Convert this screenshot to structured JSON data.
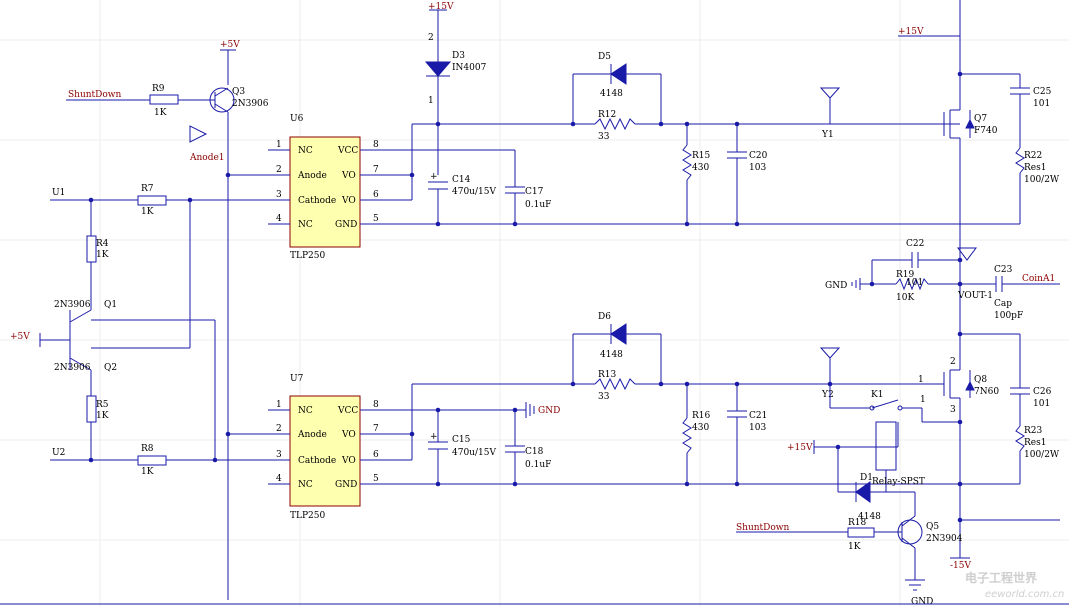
{
  "power": {
    "p15_top": "+15V",
    "p15_right": "+15V",
    "p5_q3": "+5V",
    "p5_left": "+5V",
    "p15_relay": "+15V",
    "gnd_mid": "GND",
    "gnd_c18": "GND",
    "gnd_bottom": "GND",
    "m15": "-15V"
  },
  "nets": {
    "shutdown_top": "ShuntDown",
    "shutdown_bottom": "ShuntDown",
    "u1": "U1",
    "u2": "U2",
    "coin": "CoinA1",
    "anode1": "Anode1",
    "y1": "Y1",
    "y2": "Y2",
    "vout": "VOUT-1"
  },
  "u6": {
    "ref": "U6",
    "part": "TLP250",
    "pins_left": [
      "NC",
      "Anode",
      "Cathode",
      "NC"
    ],
    "nums_left": [
      "1",
      "2",
      "3",
      "4"
    ],
    "pins_right": [
      "VCC",
      "VO",
      "VO",
      "GND"
    ],
    "nums_right": [
      "8",
      "7",
      "6",
      "5"
    ]
  },
  "u7": {
    "ref": "U7",
    "part": "TLP250",
    "pins_left": [
      "NC",
      "Anode",
      "Cathode",
      "NC"
    ],
    "nums_left": [
      "1",
      "2",
      "3",
      "4"
    ],
    "pins_right": [
      "VCC",
      "VO",
      "VO",
      "GND"
    ],
    "nums_right": [
      "8",
      "7",
      "6",
      "5"
    ]
  },
  "parts": {
    "r9": {
      "ref": "R9",
      "val": "1K"
    },
    "q3": {
      "ref": "Q3",
      "val": "2N3906"
    },
    "r7": {
      "ref": "R7",
      "val": "1K"
    },
    "r4": {
      "ref": "R4",
      "val": "1K"
    },
    "r5": {
      "ref": "R5",
      "val": "1K"
    },
    "r8": {
      "ref": "R8",
      "val": "1K"
    },
    "q1": {
      "ref": "Q1",
      "val": "2N3906"
    },
    "q2": {
      "ref": "Q2",
      "val": "2N3906"
    },
    "d3": {
      "ref": "D3",
      "val": "IN4007",
      "pin_top": "2",
      "pin_bot": "1"
    },
    "c14": {
      "ref": "C14",
      "val": "470u/15V"
    },
    "c17": {
      "ref": "C17",
      "val": "0.1uF"
    },
    "c15": {
      "ref": "C15",
      "val": "470u/15V"
    },
    "c18": {
      "ref": "C18",
      "val": "0.1uF"
    },
    "d5": {
      "ref": "D5",
      "val": "4148"
    },
    "r12": {
      "ref": "R12",
      "val": "33"
    },
    "d6": {
      "ref": "D6",
      "val": "4148"
    },
    "r13": {
      "ref": "R13",
      "val": "33"
    },
    "r15": {
      "ref": "R15",
      "val": "430"
    },
    "c20": {
      "ref": "C20",
      "val": "103"
    },
    "r16": {
      "ref": "R16",
      "val": "430"
    },
    "c21": {
      "ref": "C21",
      "val": "103"
    },
    "q7": {
      "ref": "Q7",
      "val": "F740"
    },
    "c25": {
      "ref": "C25",
      "val": "101"
    },
    "r22": {
      "ref": "R22",
      "val": "Res1",
      "val2": "100/2W"
    },
    "c22": {
      "ref": "C22",
      "val": "101"
    },
    "r19": {
      "ref": "R19",
      "val": "10K"
    },
    "c23": {
      "ref": "C23",
      "val": "Cap",
      "val2": "100pF"
    },
    "q8": {
      "ref": "Q8",
      "val": "7N60",
      "pin_top": "2",
      "pin_gate": "1",
      "pin_bot": "3"
    },
    "c26": {
      "ref": "C26",
      "val": "101"
    },
    "r23": {
      "ref": "R23",
      "val": "Res1",
      "val2": "100/2W"
    },
    "k1": {
      "ref": "K1",
      "val": "Relay-SPST"
    },
    "d1": {
      "ref": "D1",
      "val": "4148"
    },
    "r18": {
      "ref": "R18",
      "val": "1K"
    },
    "q5": {
      "ref": "Q5",
      "val": "2N3904"
    }
  },
  "watermark": {
    "cn": "电子工程世界",
    "en": "eeworld.com.cn"
  }
}
